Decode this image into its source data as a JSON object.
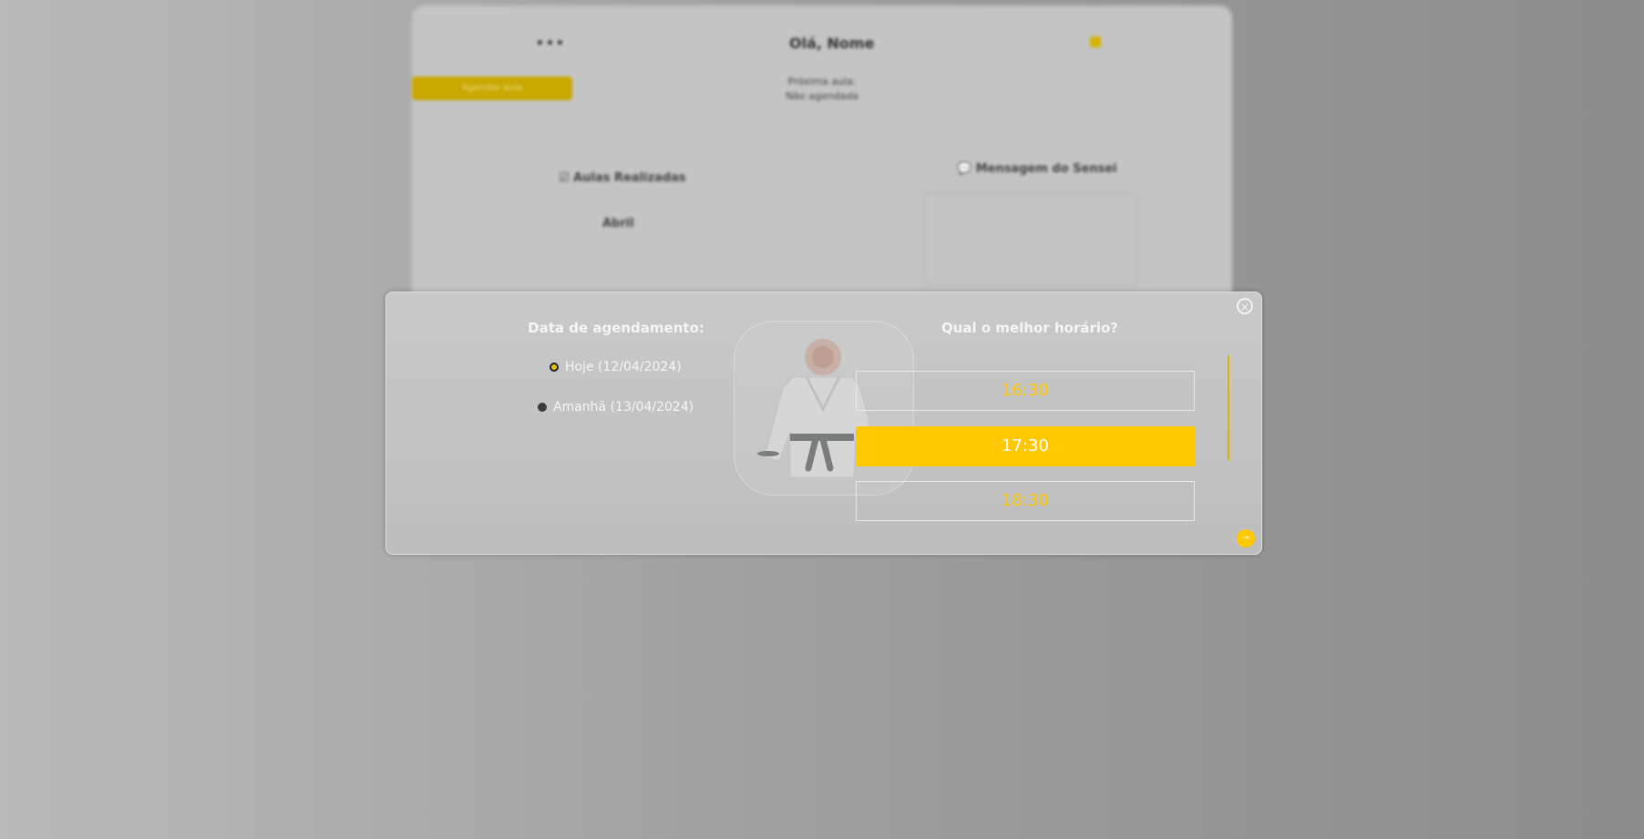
{
  "background": {
    "greeting": "Olá, Nome",
    "menu_dots": "•••",
    "schedule_button": "Agendar aula",
    "next_class_label": "Próxima aula:",
    "next_class_value": "Não agendada",
    "classes_title": "☑ Aulas Realizadas",
    "month": "Abril",
    "message_title": "💬 Mensagem do Sensei"
  },
  "modal": {
    "close_icon": "×",
    "date_title": "Data de agendamento:",
    "date_options": [
      {
        "label": "Hoje (12/04/2024)",
        "selected": true
      },
      {
        "label": "Amanhã (13/04/2024)",
        "selected": false
      }
    ],
    "time_title": "Qual o melhor horário?",
    "time_slots": [
      {
        "label": "16:30",
        "selected": false
      },
      {
        "label": "17:30",
        "selected": true
      },
      {
        "label": "18:30",
        "selected": false
      }
    ],
    "fab_icon": "→"
  },
  "colors": {
    "accent": "#ffc800",
    "modal_bg": "#c4c4c4",
    "text_light": "#f5f5f5"
  }
}
